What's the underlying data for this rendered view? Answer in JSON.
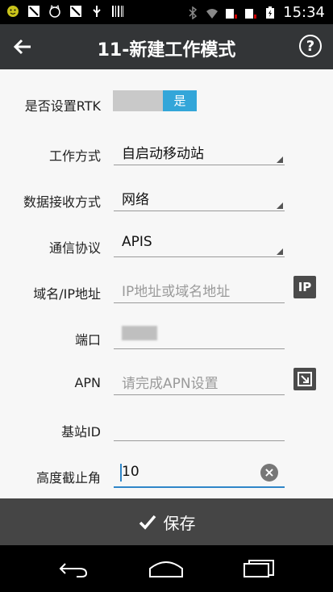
{
  "status_bar": {
    "time": "15:34",
    "icons_left": [
      "smiley-icon",
      "notification-icon",
      "cat-icon",
      "notification-icon",
      "usb-icon",
      "barcode-icon"
    ],
    "icons_right": [
      "bluetooth-icon",
      "wifi-icon",
      "sim1-icon",
      "sim2-icon",
      "battery-icon"
    ]
  },
  "header": {
    "title": "11-新建工作模式",
    "help_label": "?"
  },
  "form": {
    "rtk": {
      "label": "是否设置RTK",
      "toggle_value": "是"
    },
    "work_mode": {
      "label": "工作方式",
      "value": "自启动移动站"
    },
    "receive_mode": {
      "label": "数据接收方式",
      "value": "网络"
    },
    "protocol": {
      "label": "通信协议",
      "value": "APIS"
    },
    "host": {
      "label": "域名/IP地址",
      "placeholder": "IP地址或域名地址",
      "button_label": "IP"
    },
    "port": {
      "label": "端口",
      "value": ""
    },
    "apn": {
      "label": "APN",
      "placeholder": "请完成APN设置"
    },
    "base_id": {
      "label": "基站ID",
      "value": ""
    },
    "elevation_mask": {
      "label": "高度截止角",
      "value": "10"
    }
  },
  "footer": {
    "save_label": "保存"
  },
  "colors": {
    "accent": "#33a6d9",
    "active_underline": "#2f86c8",
    "title_bar": "#333537",
    "save_bar": "#454545"
  }
}
